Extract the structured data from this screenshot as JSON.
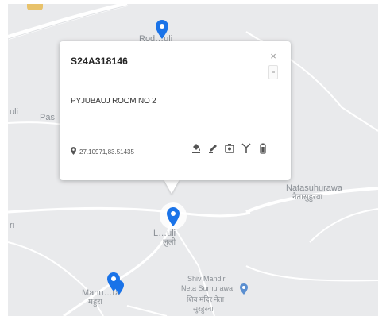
{
  "map": {
    "places": [
      {
        "id": "top",
        "name": "Rod…uli",
        "sub": ""
      },
      {
        "id": "left-top",
        "name": "Pas",
        "sub": ""
      },
      {
        "id": "left-edge",
        "name": "uli",
        "sub": ""
      },
      {
        "id": "natasuhurawa",
        "name": "Natasuhurawa",
        "sub": "नैतासुहुरवा"
      },
      {
        "id": "center",
        "name": "L…uli",
        "sub": "लुली"
      },
      {
        "id": "left-bottom",
        "name": "ri",
        "sub": ""
      },
      {
        "id": "mahu",
        "name": "Mahu…ra",
        "sub": "महुरा"
      },
      {
        "id": "shiv",
        "name": "Shiv Mandir",
        "sub": "Neta Surhurawa"
      },
      {
        "id": "shiv-hi",
        "name": "शिव मंदिर नेता",
        "sub": "सुरहुरवा"
      }
    ],
    "colors": {
      "background": "#e9eaec",
      "road": "#ffffff",
      "pin": "#1a73e8",
      "poi": "#5b8fd0"
    }
  },
  "info": {
    "title": "S24A318146",
    "close_glyph": "×",
    "description": "PYJUBAUJ ROOM NO 2",
    "coordinates": "27.10971,83.51435",
    "actions": [
      {
        "name": "fill-icon"
      },
      {
        "name": "edit-icon"
      },
      {
        "name": "camera-icon"
      },
      {
        "name": "antenna-icon"
      },
      {
        "name": "battery-icon"
      }
    ]
  }
}
